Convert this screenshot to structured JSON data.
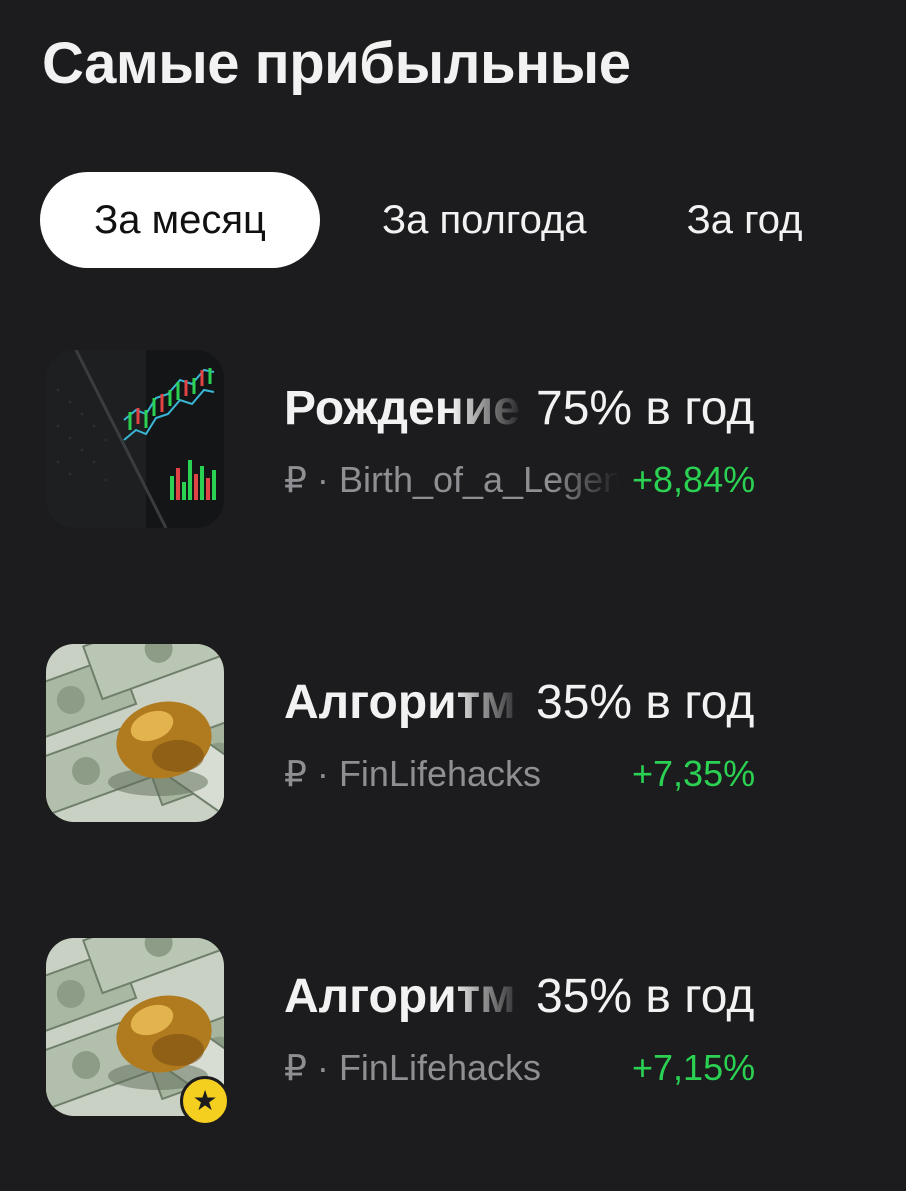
{
  "header": {
    "title": "Самые прибыльные"
  },
  "tabs": [
    {
      "label": "За месяц",
      "active": true
    },
    {
      "label": "За полгода",
      "active": false
    },
    {
      "label": "За год",
      "active": false
    }
  ],
  "strategies": [
    {
      "name": "Рождение",
      "yield": "75% в год",
      "currency": "₽",
      "author": "Birth_of_a_Legend",
      "change": "+8,84%",
      "thumbnail": "trading-chart-image",
      "favorite": false
    },
    {
      "name": "Алгоритм",
      "yield": "35% в год",
      "currency": "₽",
      "author": "FinLifehacks",
      "change": "+7,35%",
      "thumbnail": "golden-egg-dollars-image",
      "favorite": false
    },
    {
      "name": "Алгоритм",
      "yield": "35% в год",
      "currency": "₽",
      "author": "FinLifehacks",
      "change": "+7,15%",
      "thumbnail": "golden-egg-dollars-image",
      "favorite": true,
      "badge_icon": "star-icon"
    }
  ],
  "colors": {
    "background": "#1c1c1e",
    "positive": "#2bd152",
    "secondary_text": "#8e8e93",
    "badge": "#f5cf1f"
  }
}
